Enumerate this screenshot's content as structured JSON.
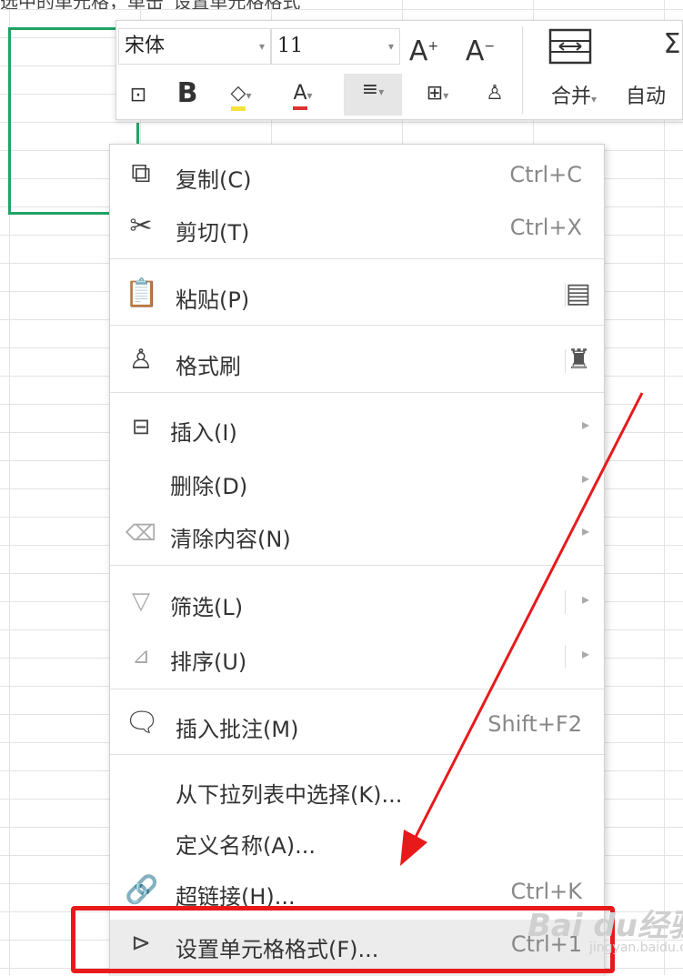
{
  "caption": "选中的单元格，单击“设置单元格格式”",
  "toolbar": {
    "font_name": "宋体",
    "font_size": "11",
    "increase_font_icon": "font-increase-icon",
    "decrease_font_icon": "font-decrease-icon",
    "merge_label": "合并",
    "autofit_label": "自动",
    "bold_label": "B"
  },
  "menu": {
    "copy": {
      "label": "复制(C)",
      "shortcut": "Ctrl+C"
    },
    "cut": {
      "label": "剪切(T)",
      "shortcut": "Ctrl+X"
    },
    "paste": {
      "label": "粘贴(P)"
    },
    "format_painter": {
      "label": "格式刷"
    },
    "insert": {
      "label": "插入(I)"
    },
    "delete": {
      "label": "删除(D)"
    },
    "clear": {
      "label": "清除内容(N)"
    },
    "filter": {
      "label": "筛选(L)"
    },
    "sort": {
      "label": "排序(U)"
    },
    "insert_comment": {
      "label": "插入批注(M)",
      "shortcut": "Shift+F2"
    },
    "pick_from_list": {
      "label": "从下拉列表中选择(K)..."
    },
    "define_name": {
      "label": "定义名称(A)..."
    },
    "hyperlink": {
      "label": "超链接(H)...",
      "shortcut": "Ctrl+K"
    },
    "format_cells": {
      "label": "设置单元格格式(F)...",
      "shortcut": "Ctrl+1"
    }
  },
  "watermark": {
    "text": "Bai du经验",
    "sub": "jingyan.baidu.com"
  },
  "colors": {
    "accent_green": "#21a366",
    "annotation_red": "#e8191b",
    "highlight_yellow": "#f5e23a",
    "font_red": "#e03030"
  }
}
